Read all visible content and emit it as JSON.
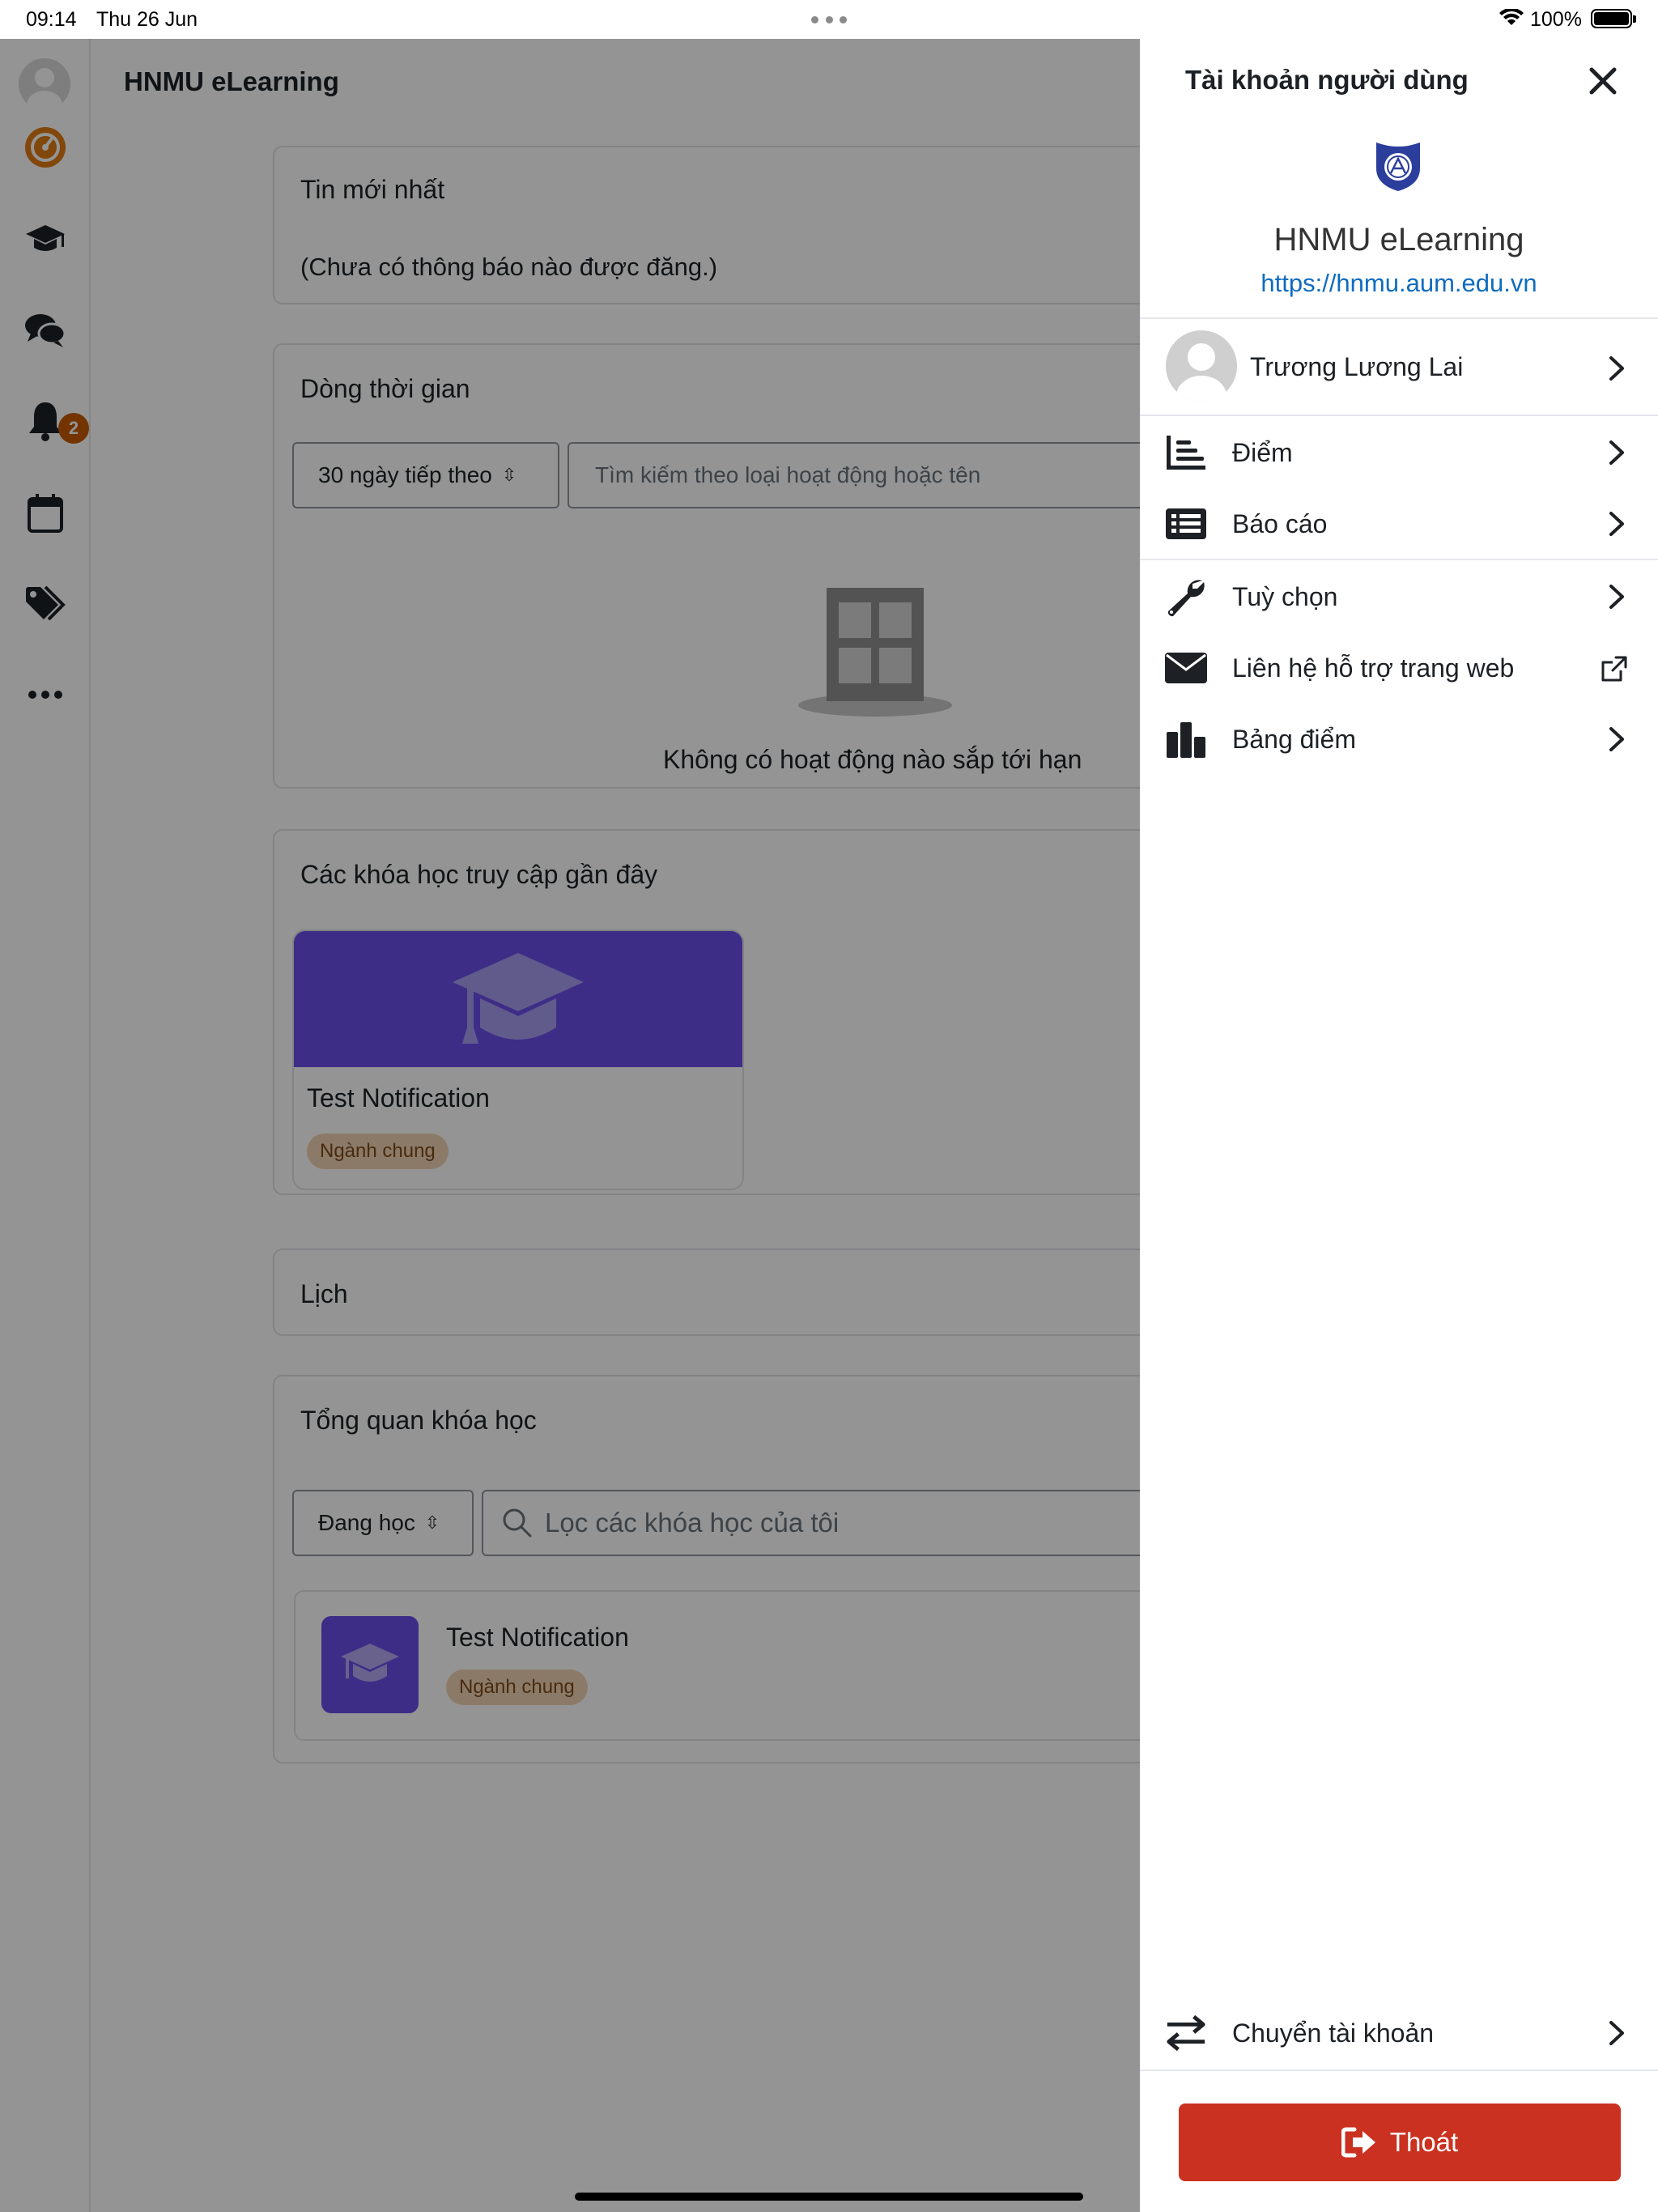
{
  "status_bar": {
    "time": "09:14",
    "date": "Thu 26 Jun",
    "battery": "100%"
  },
  "app": {
    "title": "HNMU eLearning",
    "rail": {
      "icons": [
        "avatar",
        "dashboard-icon",
        "graduation-cap-icon",
        "messages-icon",
        "bell-icon",
        "calendar-icon",
        "tags-icon",
        "more-icon"
      ],
      "notification_count": "2",
      "accent_color": "#c85a00"
    },
    "news": {
      "title": "Tin mới nhất",
      "empty_text": "(Chưa có thông báo nào được đăng.)"
    },
    "timeline": {
      "title": "Dòng thời gian",
      "range_select": "30 ngày tiếp theo",
      "search_placeholder": "Tìm kiếm theo loại hoạt động hoặc tên",
      "empty_text": "Không có hoạt động nào sắp tới hạn"
    },
    "recent_courses": {
      "title": "Các khóa học truy cập gần đây",
      "items": [
        {
          "name": "Test Notification",
          "category": "Ngành chung"
        }
      ]
    },
    "calendar": {
      "title": "Lịch"
    },
    "course_overview": {
      "title": "Tổng quan khóa học",
      "filter_select": "Đang học",
      "search_placeholder": "Lọc các khóa học của tôi",
      "items": [
        {
          "name": "Test Notification",
          "category": "Ngành chung"
        }
      ]
    }
  },
  "drawer": {
    "title": "Tài khoản người dùng",
    "site_name": "HNMU eLearning",
    "site_url": "https://hnmu.aum.edu.vn",
    "user_name": "Trương Lương Lai",
    "menu": [
      {
        "label": "Điểm",
        "icon": "grades-icon"
      },
      {
        "label": "Báo cáo",
        "icon": "report-list-icon"
      },
      {
        "label": "Tuỳ chọn",
        "icon": "wrench-icon"
      },
      {
        "label": "Liên hệ hỗ trợ trang web",
        "icon": "envelope-icon"
      },
      {
        "label": "Bảng điểm",
        "icon": "badges-bar-icon"
      }
    ],
    "switch_account": "Chuyển tài khoản",
    "logout": "Thoát",
    "logout_color": "#ca3120",
    "link_color": "#0f6cbf"
  }
}
